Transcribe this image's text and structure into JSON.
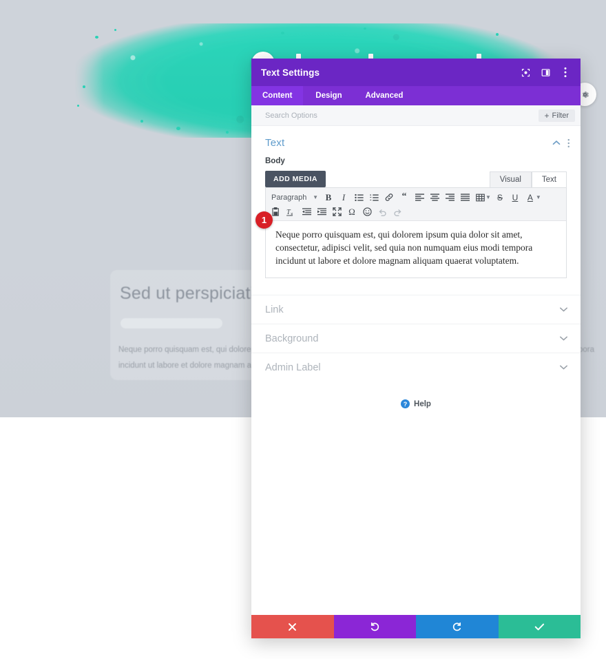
{
  "background": {
    "heading": "Sed ut perspiciatis un",
    "paragraph": "Neque porro quisquam est, qui dolorem ipsum quia dolor sit amet, consectetur, adipisci velit, sed quia non numquam eius modi tempora incidunt ut labore et dolore magnam aliquam quaerat voluptatem.",
    "brush_color": "#2ad1b6",
    "canvas_color": "#ced3da"
  },
  "modal": {
    "title": "Text Settings",
    "accent_color": "#6b26c4",
    "tab_bar_color": "#7c2fd4",
    "header_icons": [
      {
        "name": "preview-icon",
        "label": "Preview"
      },
      {
        "name": "layout-toggle-icon",
        "label": "Change Modal Position"
      },
      {
        "name": "more-options-icon",
        "label": "More Options"
      }
    ],
    "tabs": [
      {
        "label": "Content",
        "active": true
      },
      {
        "label": "Design",
        "active": false
      },
      {
        "label": "Advanced",
        "active": false
      }
    ],
    "search": {
      "placeholder": "Search Options",
      "value": ""
    },
    "filter": {
      "label": "Filter",
      "plus": "+"
    },
    "section": {
      "title": "Text",
      "collapse_icon": "chevron-up-icon",
      "menu_icon": "more-options-icon"
    },
    "field": {
      "label": "Body"
    },
    "editor": {
      "add_media_label": "ADD MEDIA",
      "mode_tabs": [
        {
          "label": "Visual",
          "active": true
        },
        {
          "label": "Text",
          "active": false
        }
      ],
      "format_select": "Paragraph",
      "toolbar_row1": [
        "bold-icon",
        "italic-icon",
        "bulleted-list-icon",
        "numbered-list-icon",
        "link-icon",
        "blockquote-icon",
        "align-left-icon",
        "align-center-icon",
        "align-right-icon",
        "align-justify-icon",
        "table-icon",
        "strikethrough-icon",
        "underline-icon",
        "text-color-icon"
      ],
      "toolbar_row2": [
        "paste-as-text-icon",
        "clear-formatting-icon",
        "outdent-icon",
        "indent-icon",
        "fullscreen-icon",
        "special-character-icon",
        "emoji-icon",
        "undo-icon",
        "redo-icon"
      ],
      "content": "Neque porro quisquam est, qui dolorem ipsum quia dolor sit amet, consectetur, adipisci velit, sed quia non numquam eius modi tempora incidunt ut labore et dolore magnam aliquam quaerat voluptatem."
    },
    "accordions": [
      {
        "label": "Link",
        "icon": "chevron-down-icon"
      },
      {
        "label": "Background",
        "icon": "chevron-down-icon"
      },
      {
        "label": "Admin Label",
        "icon": "chevron-down-icon"
      }
    ],
    "help": {
      "label": "Help",
      "badge": "?",
      "badge_color": "#2b87da"
    },
    "footer_buttons": [
      {
        "name": "discard-button",
        "icon": "close-icon",
        "color": "#e5524d"
      },
      {
        "name": "undo-button",
        "icon": "undo-icon",
        "color": "#8b26d6"
      },
      {
        "name": "redo-button",
        "icon": "redo-icon",
        "color": "#2086d6"
      },
      {
        "name": "save-button",
        "icon": "check-icon",
        "color": "#2bbd96"
      }
    ]
  },
  "callout": {
    "number": "1",
    "color": "#d81f26"
  }
}
